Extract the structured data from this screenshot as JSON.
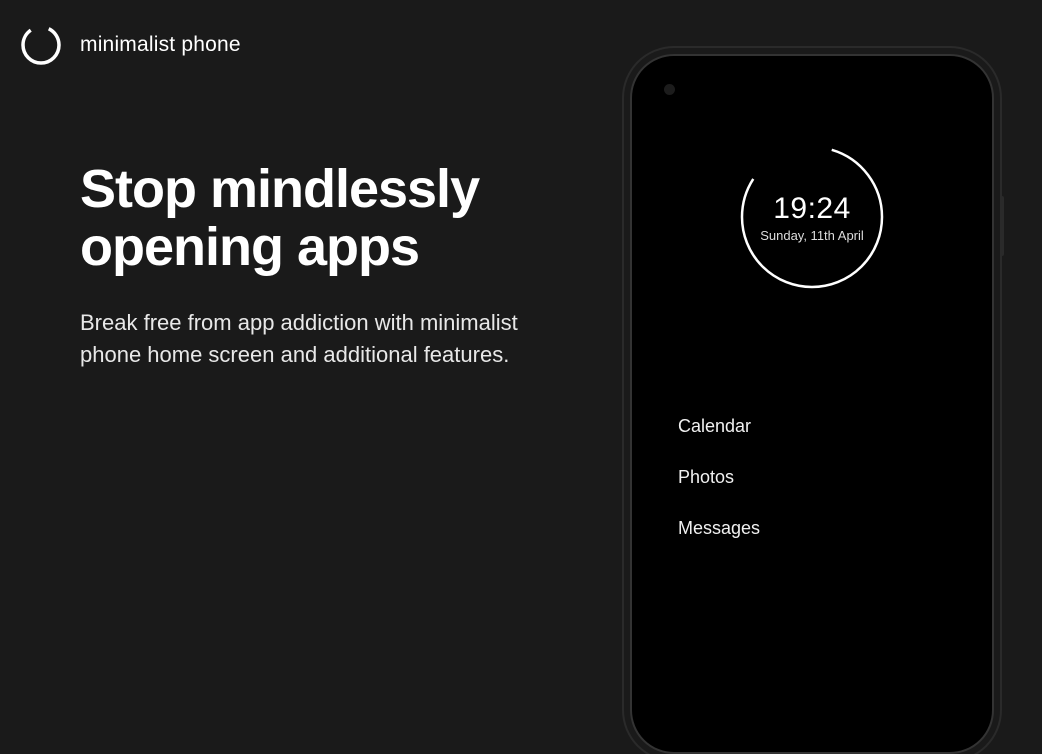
{
  "brand": "minimalist phone",
  "headline": "Stop mindlessly opening apps",
  "subtext": "Break free from app addiction with minimalist phone home screen and additional features.",
  "phone": {
    "time": "19:24",
    "date": "Sunday, 11th April",
    "apps": [
      "Calendar",
      "Photos",
      "Messages"
    ]
  }
}
